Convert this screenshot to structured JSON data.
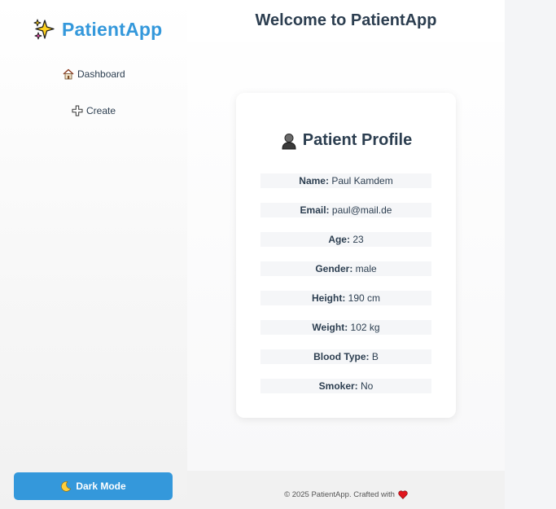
{
  "sidebar": {
    "brand": "PatientApp",
    "brand_icon": "sparkles-icon",
    "nav": [
      {
        "label": "Dashboard",
        "icon": "house-icon"
      },
      {
        "label": "Create",
        "icon": "plus-icon"
      }
    ],
    "dark_mode_label": "Dark Mode",
    "dark_mode_icon": "moon-icon"
  },
  "header": {
    "title": "Welcome to PatientApp"
  },
  "profile": {
    "title": "Patient Profile",
    "icon": "person-icon",
    "fields": [
      {
        "label": "Name:",
        "value": "Paul Kamdem"
      },
      {
        "label": "Email:",
        "value": "paul@mail.de"
      },
      {
        "label": "Age:",
        "value": "23"
      },
      {
        "label": "Gender:",
        "value": "male"
      },
      {
        "label": "Height:",
        "value": "190 cm"
      },
      {
        "label": "Weight:",
        "value": "102 kg"
      },
      {
        "label": "Blood Type:",
        "value": "B"
      },
      {
        "label": "Smoker:",
        "value": "No"
      }
    ]
  },
  "footer": {
    "text": "© 2025 PatientApp. Crafted with",
    "icon": "heart-icon"
  },
  "colors": {
    "accent": "#3498db",
    "text": "#2c3e50",
    "heart": "#e0161e"
  }
}
